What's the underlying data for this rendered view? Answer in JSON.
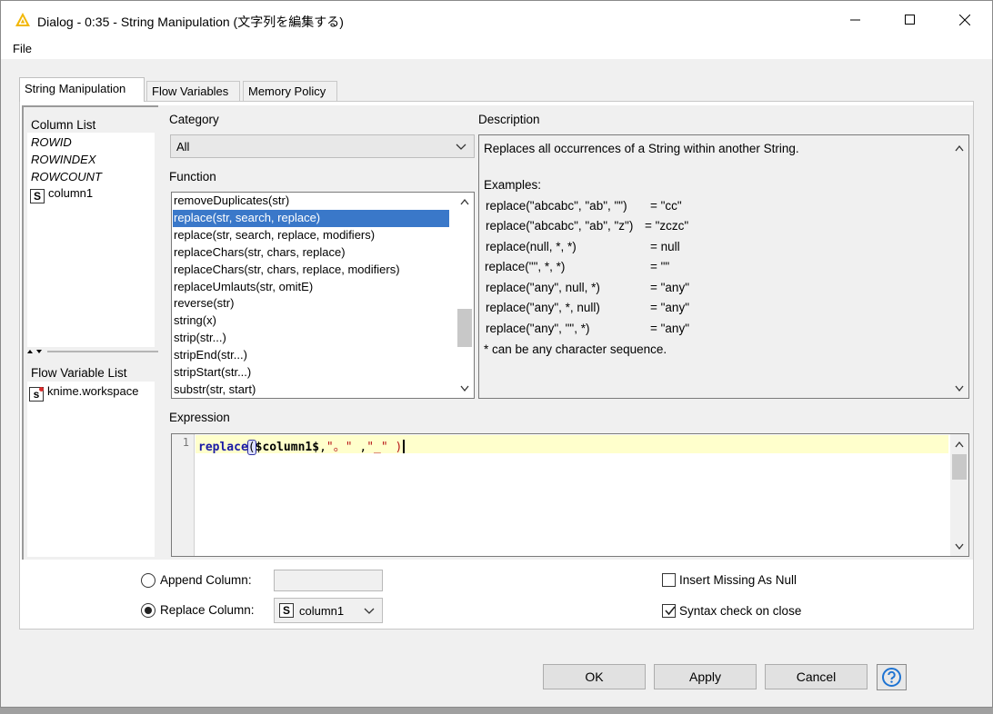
{
  "window": {
    "title": "Dialog - 0:35 - String Manipulation (文字列を編集する)",
    "menu_file": "File"
  },
  "tabs": [
    {
      "label": "String Manipulation"
    },
    {
      "label": "Flow Variables"
    },
    {
      "label": "Memory Policy"
    }
  ],
  "column_list": {
    "title": "Column List",
    "items": [
      "ROWID",
      "ROWINDEX",
      "ROWCOUNT"
    ],
    "column_type": "S",
    "column_name": "column1"
  },
  "flow_variable_list": {
    "title": "Flow Variable List",
    "type": "s",
    "item": "knime.workspace"
  },
  "category": {
    "label": "Category",
    "value": "All"
  },
  "function": {
    "label": "Function",
    "items": [
      "removeDuplicates(str)",
      "replace(str, search, replace)",
      "replace(str, search, replace, modifiers)",
      "replaceChars(str, chars, replace)",
      "replaceChars(str, chars, replace, modifiers)",
      "replaceUmlauts(str, omitE)",
      "reverse(str)",
      "string(x)",
      "strip(str...)",
      "stripEnd(str...)",
      "stripStart(str...)",
      "substr(str, start)"
    ],
    "selected_index": 1
  },
  "description": {
    "label": "Description",
    "summary": "Replaces all occurrences of a String within another String.",
    "examples_label": "Examples:",
    "examples": [
      {
        "call": "replace(\"abcabc\", \"ab\", \"\")",
        "result": "= \"cc\""
      },
      {
        "call": "replace(\"abcabc\", \"ab\", \"z\")",
        "result": "= \"zczc\""
      },
      {
        "call": "replace(null, *, *)",
        "result": "= null"
      },
      {
        "call": "replace(\"\", *, *)",
        "result": "= \"\""
      },
      {
        "call": "replace(\"any\", null, *)",
        "result": "= \"any\""
      },
      {
        "call": "replace(\"any\", *, null)",
        "result": "= \"any\""
      },
      {
        "call": "replace(\"any\", \"\", *)",
        "result": "= \"any\""
      }
    ],
    "note": "* can be any character sequence."
  },
  "expression": {
    "label": "Expression",
    "line_number": "1",
    "fn_name": "replace",
    "open_paren": "(",
    "column_ref": "$column1$",
    "comma1": ",",
    "arg_search": "\"。\"",
    "comma2": " ,",
    "arg_replace": "\"_\"",
    "close": " )"
  },
  "options": {
    "append_label": "Append Column:",
    "append_value": "",
    "replace_label": "Replace Column:",
    "replace_type": "S",
    "replace_value": "column1",
    "insert_missing_label": "Insert Missing As Null",
    "insert_missing_checked": false,
    "syntax_check_label": "Syntax check on close",
    "syntax_check_checked": true
  },
  "buttons": {
    "ok": "OK",
    "apply": "Apply",
    "cancel": "Cancel",
    "help_icon": "question-circle-icon"
  },
  "colors": {
    "selection": "#3a78c9",
    "line_highlight": "#ffffcc",
    "warning_icon": "#f2b705",
    "help_icon": "#1e73d2"
  }
}
